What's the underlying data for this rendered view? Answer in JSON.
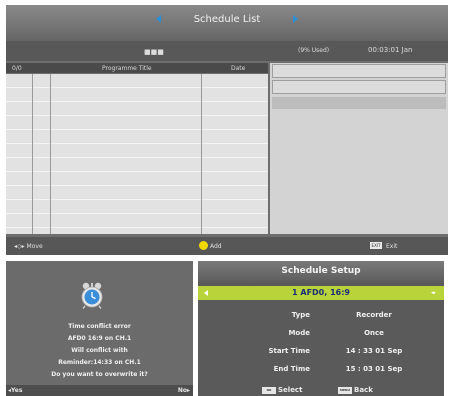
{
  "schedule_list": {
    "title": "Schedule List",
    "status_dots": "■■■",
    "usage": "(9% Used)",
    "clock": "00:03:01 Jan",
    "columns": {
      "index": "0/0",
      "title": "Programme Title",
      "date": "Date"
    },
    "footer": {
      "move": "Move",
      "add": "Add",
      "exit_key": "EXIT",
      "exit": "Exit"
    }
  },
  "conflict_dialog": {
    "lines": [
      "Time conflict error",
      "AFD0 16:9 on CH.1",
      "Will conflict with",
      "Reminder:14:33 on CH.1",
      "Do you want to overwrite it?"
    ],
    "yes": "Yes",
    "no": "No"
  },
  "schedule_setup": {
    "title": "Schedule Setup",
    "channel": "1 AFD0, 16:9",
    "rows": [
      {
        "label": "Type",
        "value": "Recorder"
      },
      {
        "label": "Mode",
        "value": "Once"
      },
      {
        "label": "Start Time",
        "value": "14 : 33   01   Sep"
      },
      {
        "label": "End Time",
        "value": "15 : 03   01   Sep"
      }
    ],
    "footer": {
      "ok_key": "OK",
      "select": "Select",
      "menu_key": "MENU",
      "back": "Back"
    }
  }
}
